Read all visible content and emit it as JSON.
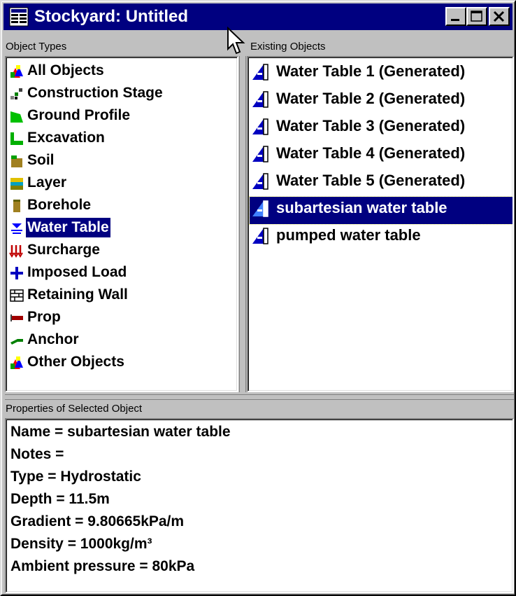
{
  "window": {
    "title": "Stockyard: Untitled",
    "title_icon": "stockyard-app-icon",
    "buttons": [
      "minimize",
      "maximize",
      "close"
    ]
  },
  "object_types": {
    "label": "Object Types",
    "selected": "Water Table",
    "items": [
      {
        "label": "All Objects",
        "icon": "all-objects-icon"
      },
      {
        "label": "Construction Stage",
        "icon": "construction-stage-icon"
      },
      {
        "label": "Ground Profile",
        "icon": "ground-profile-icon"
      },
      {
        "label": "Excavation",
        "icon": "excavation-icon"
      },
      {
        "label": "Soil",
        "icon": "soil-icon"
      },
      {
        "label": "Layer",
        "icon": "layer-icon"
      },
      {
        "label": "Borehole",
        "icon": "borehole-icon"
      },
      {
        "label": "Water Table",
        "icon": "water-table-icon"
      },
      {
        "label": "Surcharge",
        "icon": "surcharge-icon"
      },
      {
        "label": "Imposed Load",
        "icon": "imposed-load-icon"
      },
      {
        "label": "Retaining Wall",
        "icon": "retaining-wall-icon"
      },
      {
        "label": "Prop",
        "icon": "prop-icon"
      },
      {
        "label": "Anchor",
        "icon": "anchor-icon"
      },
      {
        "label": "Other Objects",
        "icon": "other-objects-icon"
      }
    ]
  },
  "existing_objects": {
    "label": "Existing Objects",
    "selected": "subartesian water table",
    "items": [
      {
        "label": "Water Table 1 (Generated)",
        "icon": "water-table-object-icon"
      },
      {
        "label": "Water Table 2 (Generated)",
        "icon": "water-table-object-icon"
      },
      {
        "label": "Water Table 3 (Generated)",
        "icon": "water-table-object-icon"
      },
      {
        "label": "Water Table 4 (Generated)",
        "icon": "water-table-object-icon"
      },
      {
        "label": "Water Table 5 (Generated)",
        "icon": "water-table-object-icon"
      },
      {
        "label": "subartesian water table",
        "icon": "water-table-object-icon"
      },
      {
        "label": "pumped water table",
        "icon": "water-table-object-icon"
      }
    ]
  },
  "properties": {
    "label": "Properties of Selected Object",
    "lines": [
      "Name = subartesian water table",
      "Notes =",
      "Type = Hydrostatic",
      "Depth = 11.5m",
      "Gradient = 9.80665kPa/m",
      "Density = 1000kg/m³",
      "Ambient pressure = 80kPa"
    ]
  },
  "colors": {
    "titlebar": "#000080",
    "selection": "#000080",
    "window_face": "#c0c0c0"
  }
}
